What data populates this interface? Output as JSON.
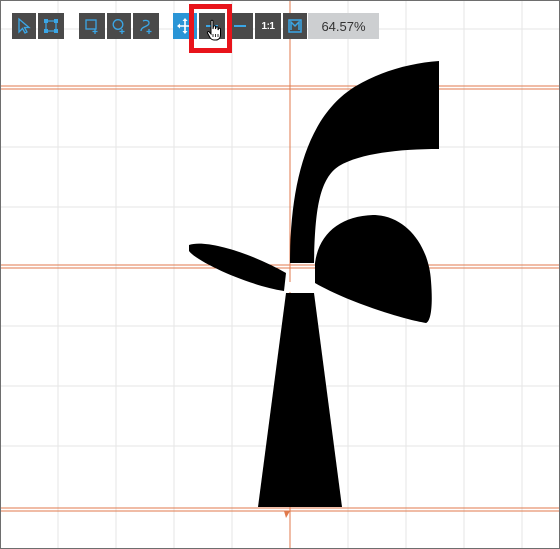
{
  "toolbar": {
    "tools": [
      {
        "name": "select-tool",
        "icon": "arrow-cursor-icon"
      },
      {
        "name": "node-tool",
        "icon": "node-select-icon"
      },
      {
        "name": "rectangle-tool",
        "icon": "rectangle-plus-icon"
      },
      {
        "name": "ellipse-tool",
        "icon": "ellipse-plus-icon"
      },
      {
        "name": "pen-tool",
        "icon": "curve-pen-icon"
      },
      {
        "name": "pan-tool",
        "icon": "move-arrows-icon",
        "active": true
      },
      {
        "name": "zoom-in-button",
        "icon": "plus-icon",
        "highlighted": true
      },
      {
        "name": "zoom-out-button",
        "icon": "minus-icon"
      },
      {
        "name": "actual-size-button",
        "icon": "one-to-one-icon"
      },
      {
        "name": "fit-to-window-button",
        "icon": "fit-window-icon"
      }
    ],
    "actual_size_label": "1:1",
    "zoom_level": "64.57%"
  },
  "colors": {
    "toolbar_button": "#4a4a4a",
    "active_button": "#2a95d6",
    "highlight_box": "#e8141b",
    "guide_line": "#e07a4c",
    "grid_line": "#e6e6e6",
    "glyph_fill": "#000000",
    "zoom_box_bg": "#cdcfd1"
  },
  "canvas": {
    "glyph_description_icon": "letter-f-glyph-outline"
  }
}
